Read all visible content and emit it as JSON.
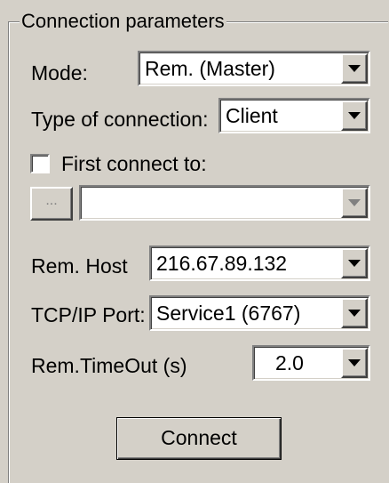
{
  "group": {
    "title": "Connection parameters"
  },
  "mode": {
    "label": "Mode:",
    "value": "Rem. (Master)"
  },
  "connection_type": {
    "label": "Type of connection:",
    "value": "Client"
  },
  "first_connect": {
    "label": "First connect to:",
    "checked": false,
    "browse_label": "...",
    "value": ""
  },
  "rem_host": {
    "label": "Rem. Host",
    "value": "216.67.89.132"
  },
  "tcp_port": {
    "label": "TCP/IP Port:",
    "value": "Service1 (6767)"
  },
  "timeout": {
    "label": "Rem.TimeOut (s)",
    "value": "2.0"
  },
  "connect_button": {
    "label": "Connect"
  },
  "colors": {
    "face": "#d4d0c8",
    "shadow": "#808080",
    "highlight": "#ffffff",
    "dark_shadow": "#404040"
  }
}
